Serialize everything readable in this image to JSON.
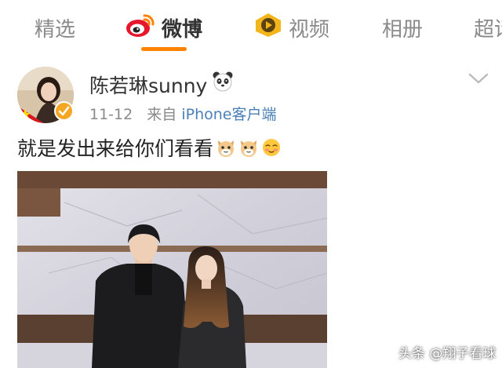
{
  "tabs": [
    {
      "label": "精选",
      "active": false
    },
    {
      "label": "微博",
      "active": true,
      "icon": "weibo-logo-icon"
    },
    {
      "label": "视频",
      "active": false,
      "icon": "video-play-icon"
    },
    {
      "label": "相册",
      "active": false
    },
    {
      "label": "超话",
      "active": false
    }
  ],
  "colors": {
    "accent": "#ff8200",
    "link": "#4a7fb8",
    "meta_text": "#8a8a8a",
    "verified_badge": "#f5a623"
  },
  "post": {
    "username": "陈若琳sunny",
    "username_icon": "panda-icon",
    "date": "11-12",
    "source_prefix": "来自",
    "source_client": "iPhone客户端",
    "text": "就是发出来给你们看看",
    "emojis": [
      "cat-emoji-icon",
      "cat-emoji-icon",
      "shy-face-emoji-icon"
    ],
    "more_icon": "chevron-down-icon"
  },
  "watermark": "头条 @翔子看球"
}
